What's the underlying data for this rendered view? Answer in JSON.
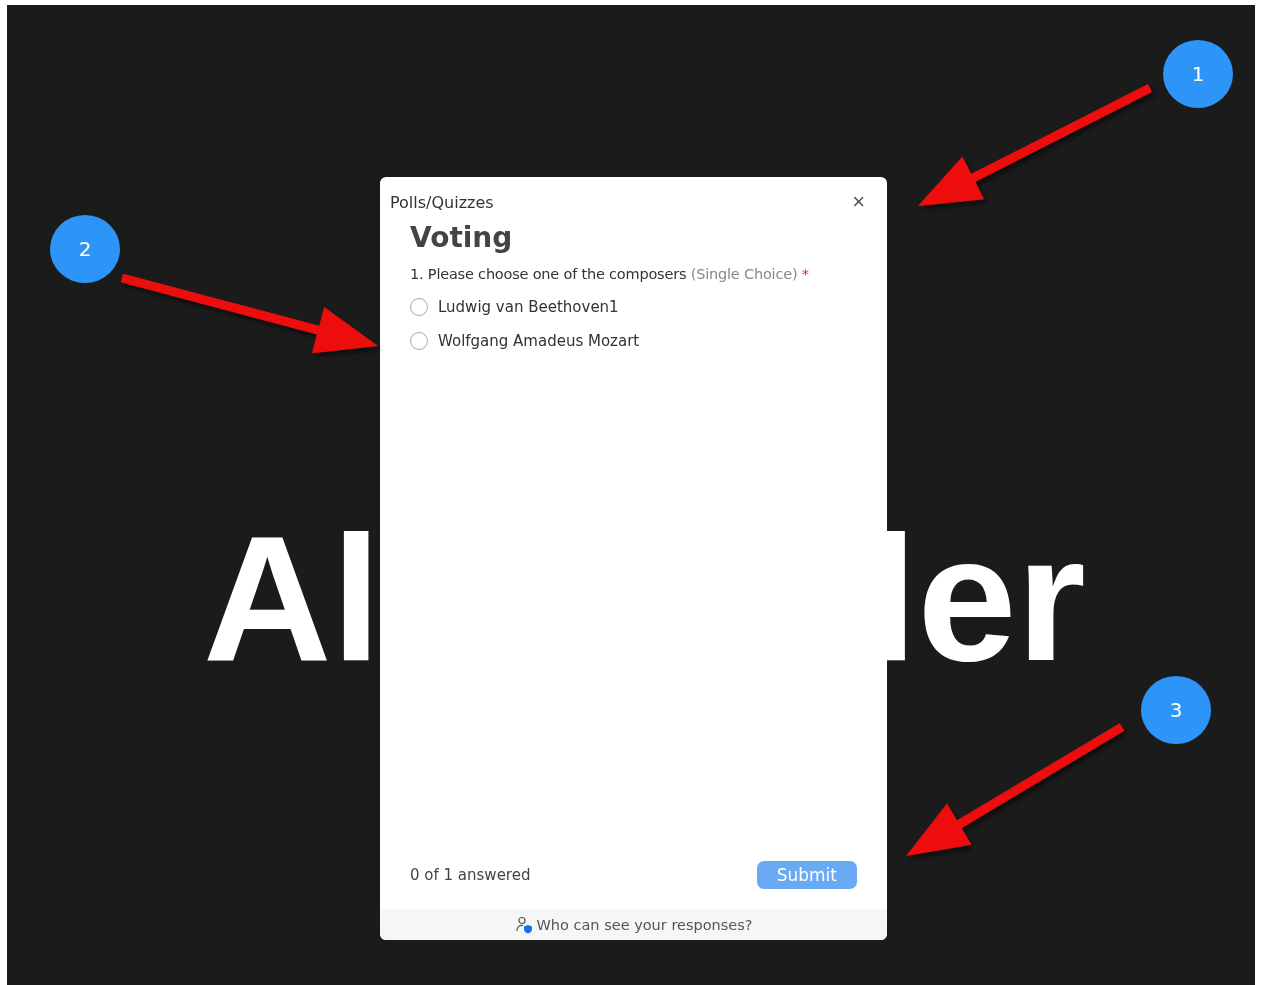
{
  "backdrop": {
    "text_left": "Al",
    "text_right": "ler"
  },
  "dialog": {
    "title": "Polls/Quizzes",
    "close": "×",
    "heading": "Voting",
    "question": {
      "number": "1.",
      "text": "Please choose one of the composers",
      "type": "(Single Choice)",
      "required": "*"
    },
    "options": [
      {
        "label": "Ludwig van Beethoven1",
        "selected": false
      },
      {
        "label": "Wolfgang Amadeus Mozart",
        "selected": false
      }
    ],
    "progress": "0 of 1 answered",
    "submit": {
      "label": "Submit",
      "disabled": true
    },
    "footer": "Who can see your responses?"
  },
  "callouts": [
    {
      "number": "1"
    },
    {
      "number": "2"
    },
    {
      "number": "3"
    }
  ]
}
